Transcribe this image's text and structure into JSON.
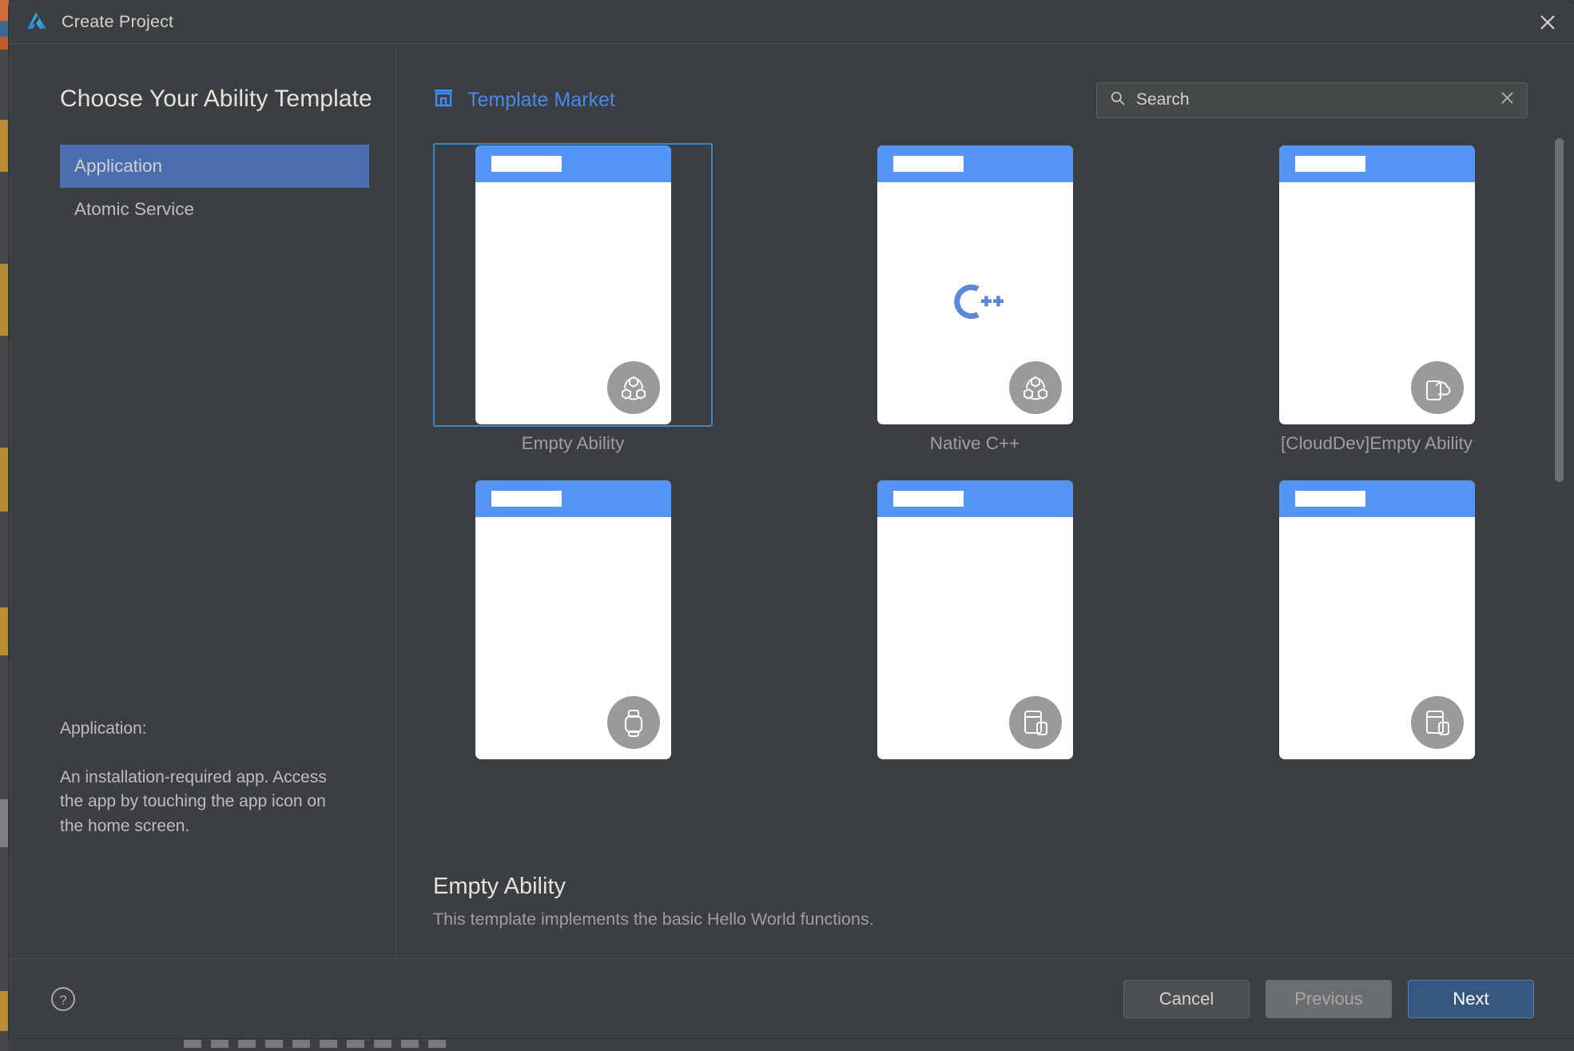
{
  "window": {
    "title": "Create Project",
    "logo_icon": "deveco-logo-icon",
    "close_icon": "close-icon"
  },
  "left_pane": {
    "heading": "Choose Your Ability Template",
    "categories": [
      {
        "label": "Application",
        "selected": true
      },
      {
        "label": "Atomic Service",
        "selected": false
      }
    ],
    "description": {
      "title": "Application:",
      "body": "An installation-required app. Access the app by touching the app icon on the home screen."
    }
  },
  "right_pane": {
    "market": {
      "label": "Template Market",
      "icon": "storefront-icon",
      "color": "#4a88e8"
    },
    "search": {
      "icon": "search-icon",
      "clear_icon": "close-icon",
      "value": "",
      "placeholder": "Search"
    },
    "templates": [
      {
        "label": "Empty Ability",
        "badge_icon": "ability-molecule-icon",
        "center_icon": "",
        "selected": true
      },
      {
        "label": "Native C++",
        "badge_icon": "ability-molecule-icon",
        "center_icon": "cpp-logo",
        "selected": false
      },
      {
        "label": "[CloudDev]Empty Ability",
        "badge_icon": "phone-cloud-icon",
        "center_icon": "",
        "selected": false
      },
      {
        "label": "",
        "badge_icon": "watch-icon",
        "center_icon": "",
        "selected": false
      },
      {
        "label": "",
        "badge_icon": "tablet-icon",
        "center_icon": "",
        "selected": false
      },
      {
        "label": "",
        "badge_icon": "tablet-icon",
        "center_icon": "",
        "selected": false
      }
    ],
    "selected_template": {
      "name": "Empty Ability",
      "description": "This template implements the basic Hello World functions."
    }
  },
  "footer": {
    "help_icon": "help-circle-icon",
    "cancel_label": "Cancel",
    "previous_label": "Previous",
    "next_label": "Next"
  },
  "colors": {
    "dialog_bg": "#3c3f41",
    "accent_blue": "#4b6eaf",
    "primary_button": "#365880",
    "phone_header": "#5495f6",
    "selection_border": "#3d86c8"
  }
}
